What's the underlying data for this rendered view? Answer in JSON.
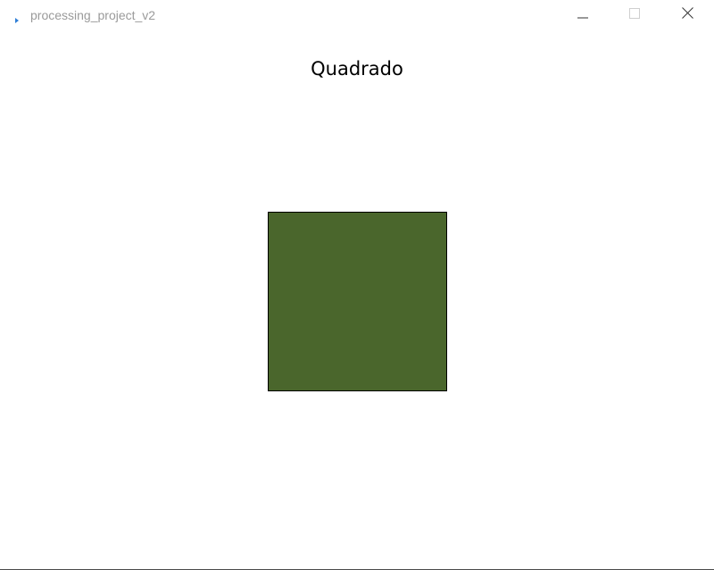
{
  "window": {
    "title": "processing_project_v2",
    "icon": "processing-app-icon",
    "controls": {
      "minimize_icon": "minimize-icon",
      "maximize_icon": "maximize-icon",
      "close_icon": "close-icon"
    }
  },
  "sketch": {
    "title": "Quadrado",
    "square": {
      "fill_color": "#4a662c",
      "stroke_color": "#000000"
    }
  }
}
